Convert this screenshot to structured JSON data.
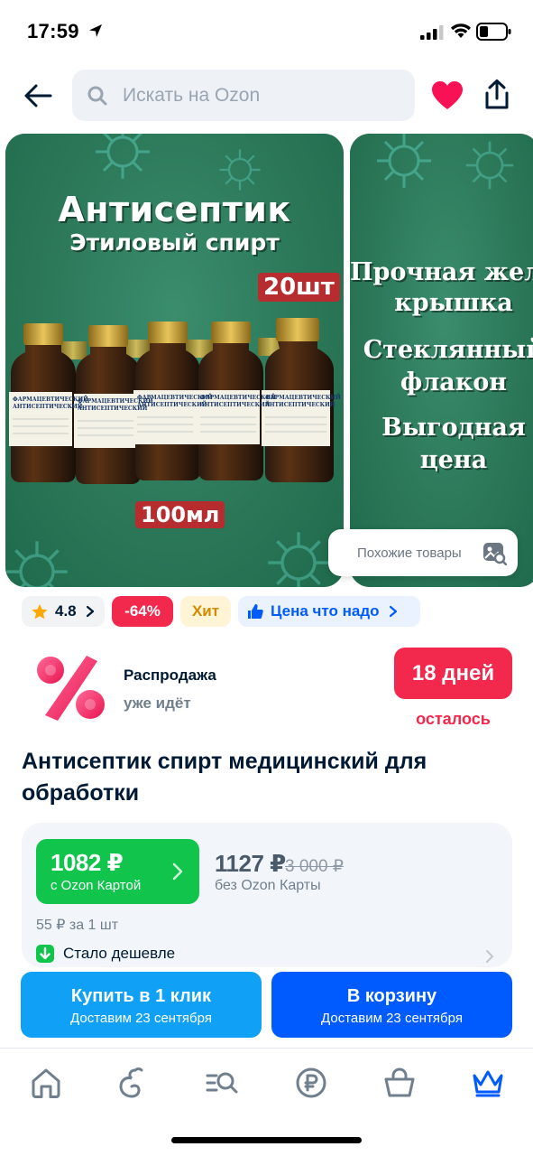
{
  "status_bar": {
    "time": "17:59"
  },
  "header": {
    "search_placeholder": "Искать на Ozon"
  },
  "gallery": {
    "slide1": {
      "title": "Антисептик",
      "subtitle": "Этиловый спирт",
      "count_tag": "20шт",
      "volume_tag": "100мл",
      "bottle_label": "ФАРМАЦЕВТИЧЕСКИЙ АНТИСЕПТИЧЕСКИЙ РАСТВОР"
    },
    "slide2": {
      "lines": [
        "Прочная желез",
        "крышка",
        "Стеклянный",
        "флакон",
        "Выгодная",
        "цена"
      ]
    },
    "similar_label": "Похожие товары"
  },
  "badges": {
    "rating": "4.8",
    "discount": "-64%",
    "hit": "Хит",
    "price_tag": "Цена что надо"
  },
  "sale": {
    "title": "Распродажа",
    "subtitle": "уже идёт",
    "days": "18 дней",
    "left": "осталось"
  },
  "product": {
    "title": "Антисептик спирт медицинский для обработки"
  },
  "price": {
    "ozon_price": "1082 ₽",
    "ozon_caption": "с Ozon Картой",
    "regular_price": "1127 ₽",
    "old_price": "3 000 ₽",
    "regular_caption": "без Ozon Карты",
    "per_unit": "55 ₽  за 1 шт",
    "cheaper": "Стало дешевле"
  },
  "actions": {
    "buy_label": "Купить в 1 клик",
    "buy_sub": "Доставим 23 сентября",
    "cart_label": "В корзину",
    "cart_sub": "Доставим 23 сентября"
  },
  "nav": {
    "items": [
      "home-icon",
      "fresh-icon",
      "catalog-icon",
      "ozon-bank-icon",
      "cart-icon",
      "premium-icon"
    ],
    "active": "premium-icon"
  },
  "colors": {
    "brand_blue": "#005bff",
    "sale_red": "#f2284d",
    "ozon_green": "#10c44c",
    "buy_blue": "#10a0f5"
  }
}
